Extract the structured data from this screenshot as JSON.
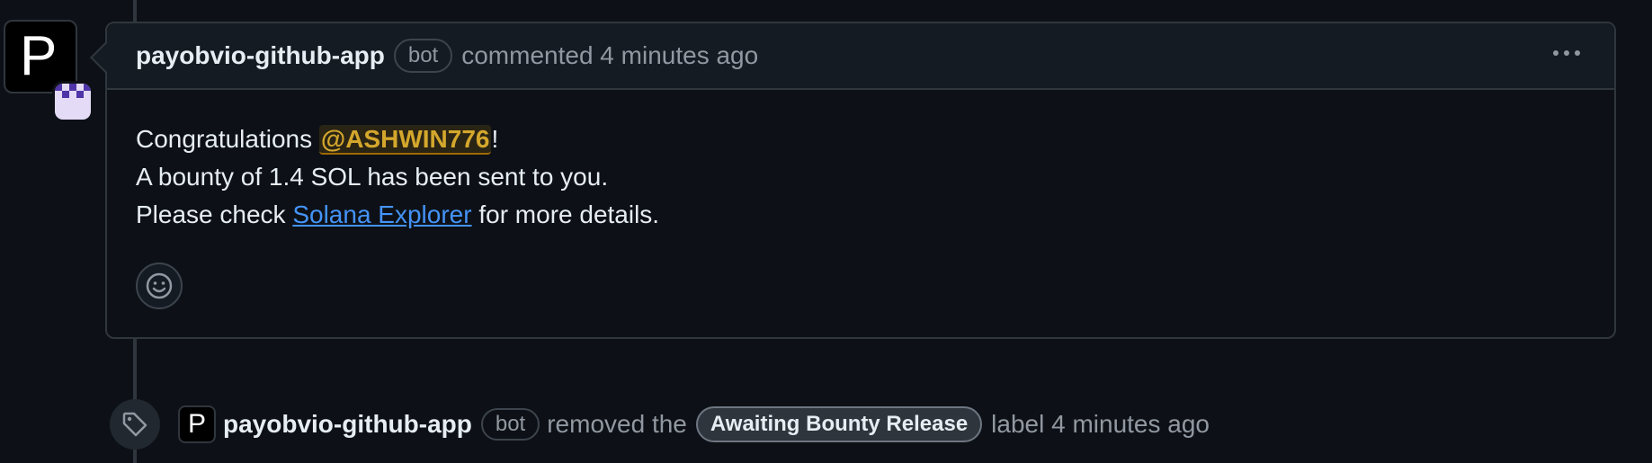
{
  "comment": {
    "author": "payobvio-github-app",
    "bot_label": "bot",
    "meta": "commented 4 minutes ago",
    "body": {
      "line1_prefix": "Congratulations ",
      "mention": "@ASHWIN776",
      "line1_suffix": "!",
      "line2": "A bounty of 1.4 SOL has been sent to you.",
      "line3_prefix": "Please check ",
      "link_text": "Solana Explorer",
      "line3_suffix": " for more details."
    },
    "avatar_letter": "P"
  },
  "event": {
    "avatar_letter": "P",
    "author": "payobvio-github-app",
    "bot_label": "bot",
    "action": "removed the",
    "label_name": "Awaiting Bounty Release",
    "suffix": "label 4 minutes ago"
  },
  "icons": {
    "menu": "kebab-horizontal-icon",
    "reaction": "smiley-icon",
    "event": "tag-icon"
  }
}
